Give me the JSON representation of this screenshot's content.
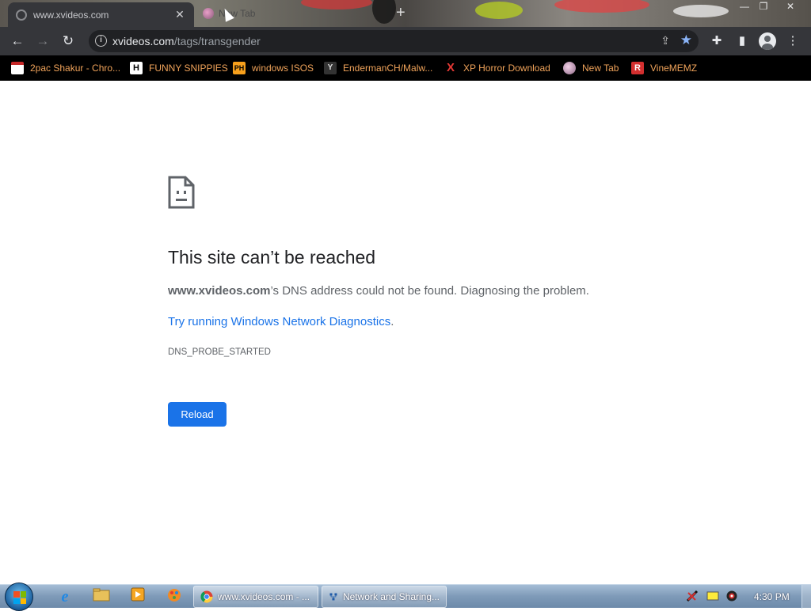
{
  "browser": {
    "active_tab_title": "www.xvideos.com",
    "second_tab_title": "New Tab",
    "url_host": "xvideos.com",
    "url_path": "/tags/transgender"
  },
  "bookmarks": [
    {
      "label": "2pac Shakur - Chro...",
      "icon": "calendar-icon",
      "icon_text": "",
      "icon_color": "#c62828"
    },
    {
      "label": "FUNNY SNIPPIES",
      "icon": "h-icon",
      "icon_text": "H",
      "icon_color": "#ffffff"
    },
    {
      "label": "windows ISOS",
      "icon": "ph-icon",
      "icon_text": "PH",
      "icon_color": "#f7a01c"
    },
    {
      "label": "EndermanCH/Malw...",
      "icon": "yp-icon",
      "icon_text": "Y",
      "icon_color": "#9a9a9a"
    },
    {
      "label": "XP Horror Download",
      "icon": "x-icon",
      "icon_text": "X",
      "icon_color": "#e53935"
    },
    {
      "label": "New Tab",
      "icon": "new-tab-icon",
      "icon_text": "",
      "icon_color": "#9a7fa0"
    },
    {
      "label": "VineMEMZ",
      "icon": "r-icon",
      "icon_text": "R",
      "icon_color": "#d32f2f"
    }
  ],
  "error": {
    "heading": "This site can’t be reached",
    "host": "www.xvideos.com",
    "desc_rest": "’s DNS address could not be found. Diagnosing the problem.",
    "suggest_link": "Try running Windows Network Diagnostics",
    "suggest_tail": ".",
    "code": "DNS_PROBE_STARTED",
    "reload_label": "Reload"
  },
  "taskbar": {
    "tasks": [
      {
        "label": "www.xvideos.com - ..."
      },
      {
        "label": "Network and Sharing..."
      }
    ],
    "clock": "4:30 PM"
  },
  "colors": {
    "accent": "#1a73e8",
    "bookmark_text": "#f0a35a",
    "toolbar": "#35363a"
  }
}
